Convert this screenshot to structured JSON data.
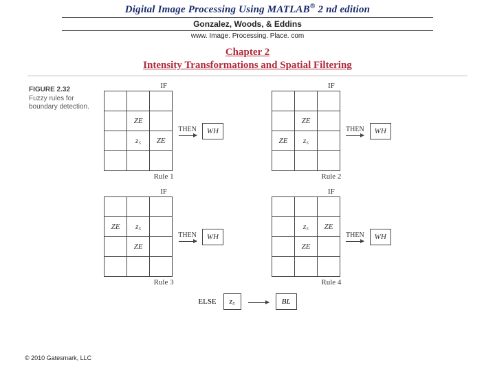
{
  "header": {
    "title_prefix": "Digital Image Processing Using MATLAB",
    "reg": "®",
    "title_suffix": " 2 nd edition",
    "authors": "Gonzalez, Woods, & Eddins",
    "url": "www. Image. Processing. Place. com"
  },
  "chapter": {
    "num": "Chapter 2",
    "title": "Intensity Transformations and Spatial Filtering"
  },
  "figure": {
    "num": "FIGURE 2.32",
    "caption": "Fuzzy rules for boundary detection."
  },
  "labels": {
    "IF": "IF",
    "THEN": "THEN",
    "ELSE": "ELSE",
    "WH": "WH",
    "BL": "BL",
    "ZE": "ZE",
    "z5": "z₅"
  },
  "rules": {
    "r1": "Rule 1",
    "r2": "Rule 2",
    "r3": "Rule 3",
    "r4": "Rule 4"
  },
  "copyright": "© 2010 Gatesmark, LLC"
}
